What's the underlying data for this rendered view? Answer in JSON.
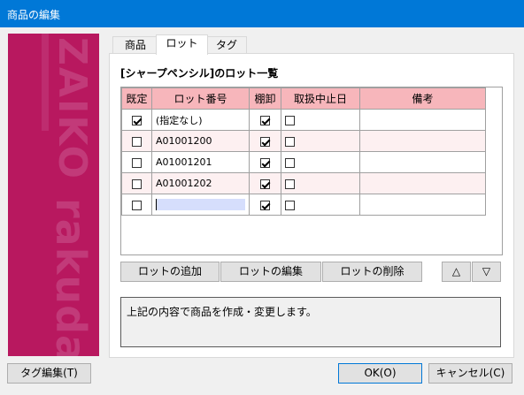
{
  "window": {
    "title": "商品の編集"
  },
  "sidebar": {
    "watermark_top": "ZAIKO",
    "watermark_bottom": "rakuda"
  },
  "tabs": [
    {
      "label": "商品",
      "active": false
    },
    {
      "label": "ロット",
      "active": true
    },
    {
      "label": "タグ",
      "active": false
    }
  ],
  "lot_panel": {
    "heading": "[シャープペンシル]のロット一覧",
    "columns": [
      "既定",
      "ロット番号",
      "棚卸",
      "取扱中止日",
      "備考"
    ],
    "rows": [
      {
        "default": true,
        "lot": "(指定なし)",
        "inventory": true,
        "discontinued": false,
        "note": ""
      },
      {
        "default": false,
        "lot": "A01001200",
        "inventory": true,
        "discontinued": false,
        "note": ""
      },
      {
        "default": false,
        "lot": "A01001201",
        "inventory": true,
        "discontinued": false,
        "note": ""
      },
      {
        "default": false,
        "lot": "A01001202",
        "inventory": true,
        "discontinued": false,
        "note": ""
      },
      {
        "default": false,
        "lot": "",
        "inventory": true,
        "discontinued": false,
        "note": ""
      }
    ],
    "buttons": {
      "add": "ロットの追加",
      "edit": "ロットの編集",
      "delete": "ロットの削除",
      "up": "△",
      "down": "▽"
    },
    "message": "上記の内容で商品を作成・変更します。"
  },
  "footer": {
    "tag_edit": "タグ編集(T)",
    "ok": "OK(O)",
    "cancel": "キャンセル(C)"
  }
}
